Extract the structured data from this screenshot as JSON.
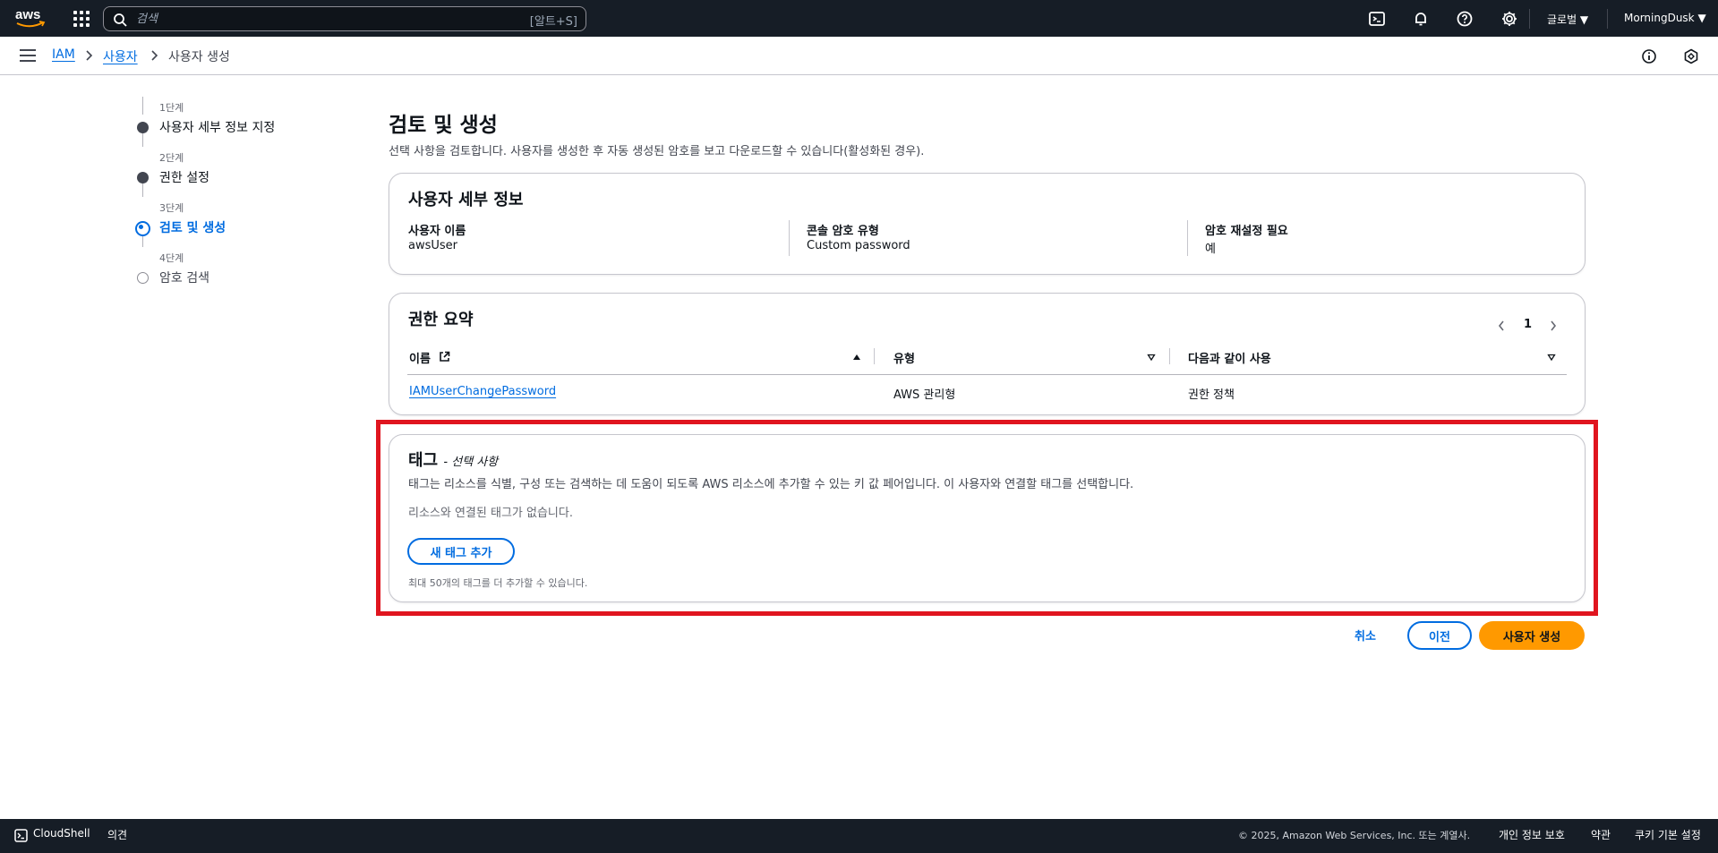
{
  "topnav": {
    "search_placeholder": "검색",
    "search_shortcut": "[알트+S]",
    "region": "글로벌 ▼",
    "account": "MorningDusk ▼"
  },
  "breadcrumb": {
    "items": [
      "IAM",
      "사용자",
      "사용자 생성"
    ]
  },
  "steps": [
    {
      "num": "1단계",
      "title": "사용자 세부 정보 지정"
    },
    {
      "num": "2단계",
      "title": "권한 설정"
    },
    {
      "num": "3단계",
      "title": "검토 및 생성"
    },
    {
      "num": "4단계",
      "title": "암호 검색"
    }
  ],
  "page": {
    "title": "검토 및 생성",
    "description": "선택 사항을 검토합니다. 사용자를 생성한 후 자동 생성된 암호를 보고 다운로드할 수 있습니다(활성화된 경우)."
  },
  "user_details": {
    "title": "사용자 세부 정보",
    "fields": [
      {
        "label": "사용자 이름",
        "value": "awsUser"
      },
      {
        "label": "콘솔 암호 유형",
        "value": "Custom password"
      },
      {
        "label": "암호 재설정 필요",
        "value": "예"
      }
    ]
  },
  "permissions": {
    "title": "권한 요약",
    "page": "1",
    "columns": [
      "이름",
      "유형",
      "다음과 같이 사용"
    ],
    "rows": [
      {
        "name": "IAMUserChangePassword",
        "type": "AWS 관리형",
        "used_as": "권한 정책"
      }
    ]
  },
  "tags": {
    "title": "태그",
    "optional": "- 선택 사항",
    "description": "태그는 리소스를 식별, 구성 또는 검색하는 데 도움이 되도록 AWS 리소스에 추가할 수 있는 키 값 페어입니다. 이 사용자와 연결할 태그를 선택합니다.",
    "empty": "리소스와 연결된 태그가 없습니다.",
    "add_button": "새 태그 추가",
    "hint": "최대 50개의 태그를 더 추가할 수 있습니다."
  },
  "actions": {
    "cancel": "취소",
    "previous": "이전",
    "create": "사용자 생성"
  },
  "footer": {
    "cloudshell": "CloudShell",
    "feedback": "의견",
    "copyright": "© 2025, Amazon Web Services, Inc. 또는 계열사.",
    "privacy": "개인 정보 보호",
    "terms": "약관",
    "cookies": "쿠키 기본 설정"
  },
  "colors": {
    "nav_bg": "#161d26",
    "link": "#006ce0",
    "primary": "#ff9900",
    "highlight": "#e0151f"
  }
}
